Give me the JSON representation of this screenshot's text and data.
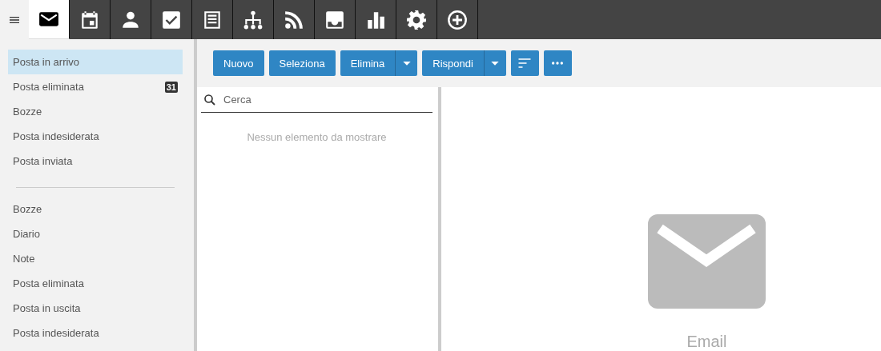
{
  "nav": {
    "tabs": [
      {
        "selected": true
      },
      {
        "selected": false
      },
      {
        "selected": false
      },
      {
        "selected": false
      },
      {
        "selected": false
      },
      {
        "selected": false
      },
      {
        "selected": false
      },
      {
        "selected": false
      },
      {
        "selected": false
      },
      {
        "selected": false
      },
      {
        "selected": false
      }
    ]
  },
  "sidebar": {
    "groups": [
      {
        "items": [
          {
            "label": "Posta in arrivo",
            "selected": true
          },
          {
            "label": "Posta eliminata",
            "selected": false,
            "badge": "31"
          },
          {
            "label": "Bozze",
            "selected": false
          },
          {
            "label": "Posta indesiderata",
            "selected": false
          },
          {
            "label": "Posta inviata",
            "selected": false
          }
        ]
      },
      {
        "items": [
          {
            "label": "Bozze",
            "selected": false
          },
          {
            "label": "Diario",
            "selected": false
          },
          {
            "label": "Note",
            "selected": false
          },
          {
            "label": "Posta eliminata",
            "selected": false
          },
          {
            "label": "Posta in uscita",
            "selected": false
          },
          {
            "label": "Posta indesiderata",
            "selected": false
          }
        ]
      }
    ]
  },
  "toolbar": {
    "buttons": [
      {
        "label": "Nuovo",
        "dropdown": false
      },
      {
        "label": "Seleziona",
        "dropdown": false
      },
      {
        "label": "Elimina",
        "dropdown": true
      },
      {
        "label": "Rispondi",
        "dropdown": true
      }
    ]
  },
  "message_list": {
    "search": {
      "placeholder": "Cerca"
    },
    "empty_text": "Nessun elemento da mostrare"
  },
  "reading_pane": {
    "label": "Email"
  }
}
